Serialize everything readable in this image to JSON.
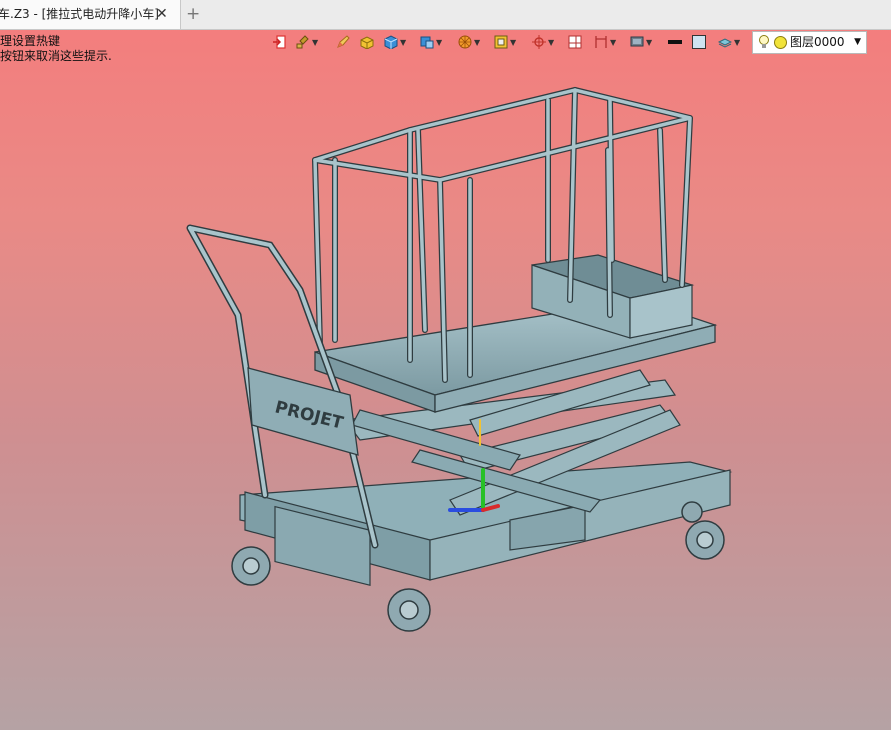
{
  "tab": {
    "title": "车.Z3 - [推拉式电动升降小车]",
    "close": "✕",
    "add": "+"
  },
  "hint": {
    "line1": "理设置热键",
    "line2": "按钮来取消这些提示."
  },
  "toolbar": {
    "icons": [
      "import-icon",
      "brush-icon",
      "pencil-icon",
      "box-material-icon",
      "cube-icon",
      "view-cube-icon",
      "render-sphere-icon",
      "frame-icon",
      "snap-target-icon",
      "split-view-icon",
      "dimension-icon",
      "display-icon",
      "line-color-icon",
      "fill-color-icon",
      "layer-stack-icon"
    ]
  },
  "layer": {
    "value": "图层0000",
    "arrow": "▼"
  },
  "model": {
    "label": "PROJET"
  },
  "colors": {
    "metal": "#9fbcc4",
    "metal_dark": "#5d7a82",
    "edge": "#2f3c40",
    "bg_top": "#f57c7c",
    "bg_bottom": "#b5a2a4"
  }
}
